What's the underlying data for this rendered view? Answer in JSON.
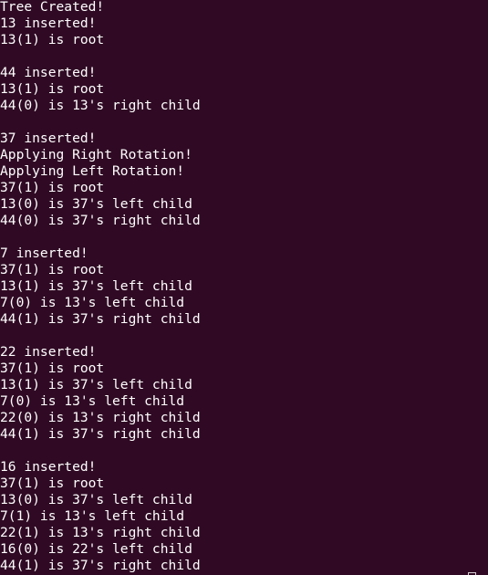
{
  "terminal": {
    "lines": [
      "Tree Created!",
      "13 inserted!",
      "13(1) is root",
      "",
      "44 inserted!",
      "13(1) is root",
      "44(0) is 13's right child",
      "",
      "37 inserted!",
      "Applying Right Rotation!",
      "Applying Left Rotation!",
      "37(1) is root",
      "13(0) is 37's left child",
      "44(0) is 37's right child",
      "",
      "7 inserted!",
      "37(1) is root",
      "13(1) is 37's left child",
      "7(0) is 13's left child",
      "44(1) is 37's right child",
      "",
      "22 inserted!",
      "37(1) is root",
      "13(1) is 37's left child",
      "7(0) is 13's left child",
      "22(0) is 13's right child",
      "44(1) is 37's right child",
      "",
      "16 inserted!",
      "37(1) is root",
      "13(0) is 37's left child",
      "7(1) is 13's left child",
      "22(1) is 13's right child",
      "16(0) is 22's left child",
      "44(1) is 37's right child"
    ]
  },
  "colors": {
    "background": "#300a24",
    "text": "#ffffff"
  }
}
